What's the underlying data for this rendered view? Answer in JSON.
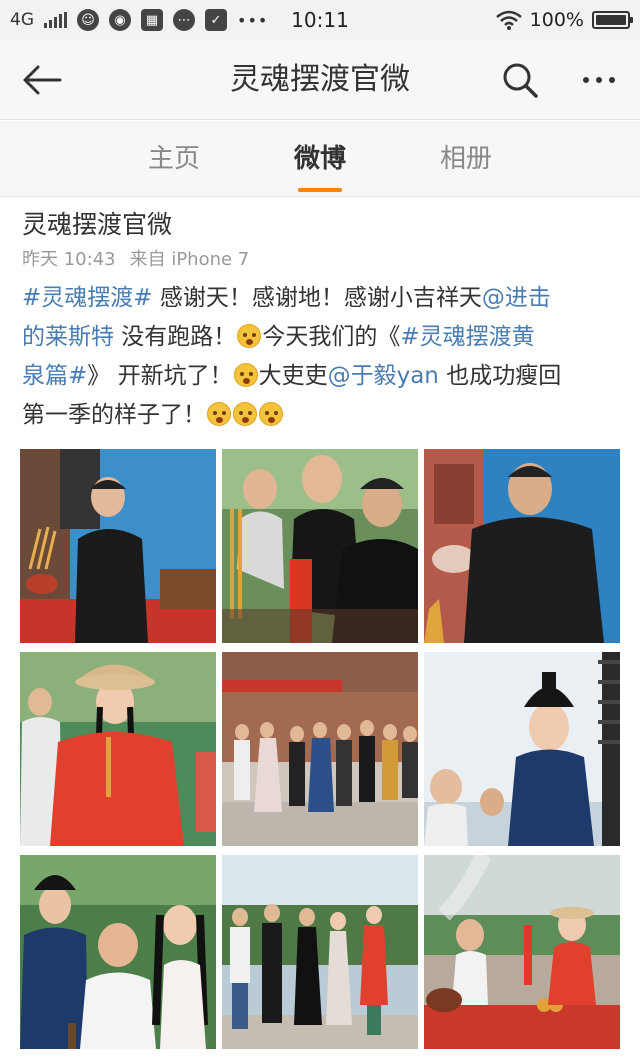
{
  "status_bar": {
    "network": "4G",
    "time": "10:11",
    "battery": "100%",
    "battery_level": 1.0,
    "icons": [
      "signal-icon",
      "qq-icon",
      "weibo-icon",
      "taobao-icon",
      "message-icon",
      "task-icon",
      "more-icon",
      "wifi-icon",
      "battery-icon"
    ]
  },
  "nav": {
    "title": "灵魂摆渡官微",
    "back_icon": "back-arrow-icon",
    "search_icon": "search-icon",
    "more_icon": "more-icon"
  },
  "tabs": [
    {
      "label": "主页",
      "active": false
    },
    {
      "label": "微博",
      "active": true
    },
    {
      "label": "相册",
      "active": false
    }
  ],
  "accent_color": "#ff8200",
  "link_color": "#4a7cb1",
  "post": {
    "author": "灵魂摆渡官微",
    "time": "昨天 10:43",
    "source": "来自 iPhone 7",
    "text": {
      "l1_tag": "#灵魂摆渡#",
      "l1_text": " 感谢天！感谢地！感谢小吉祥天",
      "l1_mention": "@进击",
      "l2_mention": "的莱斯特",
      "l2_text": " 没有跑路！",
      "l2_text2": "今天我们的《",
      "l2_tag": "#灵魂摆渡黄",
      "l3_tag": "泉篇#",
      "l3_text": "》 开新坑了！",
      "l3_text2": "大吏吏",
      "l3_mention": "@于毅yan",
      "l3_text3": " 也成功瘦回",
      "l4_text": "第一季的样子了！"
    },
    "photos": [
      {
        "name": "photo-1"
      },
      {
        "name": "photo-2"
      },
      {
        "name": "photo-3"
      },
      {
        "name": "photo-4"
      },
      {
        "name": "photo-5"
      },
      {
        "name": "photo-6"
      },
      {
        "name": "photo-7"
      },
      {
        "name": "photo-8"
      },
      {
        "name": "photo-9"
      }
    ]
  }
}
